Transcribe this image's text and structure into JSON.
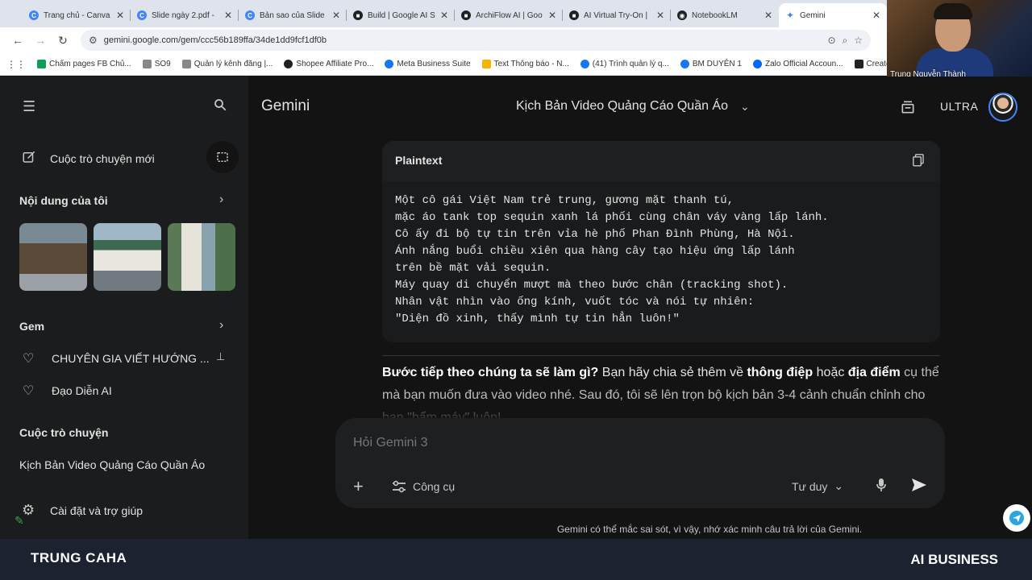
{
  "browser": {
    "tabs": [
      {
        "label": "Trang chủ - Canva",
        "color": "#4285f4"
      },
      {
        "label": "Slide ngày 2.pdf -",
        "color": "#4285f4"
      },
      {
        "label": "Bản sao của Slide",
        "color": "#4285f4"
      },
      {
        "label": "Build | Google AI S",
        "color": "#202124"
      },
      {
        "label": "ArchiFlow AI | Goo",
        "color": "#202124"
      },
      {
        "label": "AI Virtual Try-On |",
        "color": "#202124"
      },
      {
        "label": "NotebookLM",
        "color": "#202124"
      },
      {
        "label": "Gemini",
        "color": "#4285f4"
      }
    ],
    "url": "gemini.google.com/gem/ccc56b189ffa/34de1dd9fcf1df0b",
    "bookmarks": [
      {
        "label": "Chấm pages FB Chủ...",
        "color": "#0f9d58"
      },
      {
        "label": "SO9",
        "color": "#888888"
      },
      {
        "label": "Quản lý kênh đăng |...",
        "color": "#888888"
      },
      {
        "label": "Shopee Affiliate Pro...",
        "color": "#222222"
      },
      {
        "label": "Meta Business Suite",
        "color": "#1877f2"
      },
      {
        "label": "Text Thông báo - N...",
        "color": "#f4b400"
      },
      {
        "label": "(41) Trình quản lý q...",
        "color": "#1877f2"
      },
      {
        "label": "BM DUYÊN 1",
        "color": "#1877f2"
      },
      {
        "label": "Zalo Official Accoun...",
        "color": "#0068ff"
      },
      {
        "label": "Create Vide",
        "color": "#222222"
      }
    ],
    "webcam_name": "Trung Nguyễn Thành"
  },
  "sidebar": {
    "new_chat": "Cuộc trò chuyện mới",
    "my_content": "Nội dung của tôi",
    "gem_heading": "Gem",
    "gems": [
      {
        "label": "CHUYÊN GIA VIẾT HƯỚNG ..."
      },
      {
        "label": "Đạo Diễn AI"
      }
    ],
    "chats_heading": "Cuộc trò chuyện",
    "chats": [
      {
        "label": "Kịch Bản Video Quảng Cáo Quần Áo"
      }
    ],
    "settings": "Cài đặt và trợ giúp"
  },
  "header": {
    "brand": "Gemini",
    "conversation_title": "Kịch Bản Video Quảng Cáo Quần Áo",
    "plan": "ULTRA"
  },
  "code_block": {
    "language": "Plaintext",
    "lines": [
      "Một cô gái Việt Nam trẻ trung, gương mặt thanh tú,",
      "mặc áo tank top sequin xanh lá phối cùng chân váy vàng lấp lánh.",
      "Cô ấy đi bộ tự tin trên vỉa hè phố Phan Đình Phùng, Hà Nội.",
      "Ánh nắng buổi chiều xiên qua hàng cây tạo hiệu ứng lấp lánh",
      "trên bề mặt vải sequin.",
      "Máy quay di chuyển mượt mà theo bước chân (tracking shot).",
      "Nhân vật nhìn vào ống kính, vuốt tóc và nói tự nhiên:",
      "\"Diện đồ xinh, thấy mình tự tin hẳn luôn!\""
    ]
  },
  "reply": {
    "q_bold": "Bước tiếp theo chúng ta sẽ làm gì?",
    "t1": " Bạn hãy chia sẻ thêm về ",
    "b1": "thông điệp",
    "t2": " hoặc ",
    "b2": "địa điểm",
    "t3": " cụ thể mà bạn muốn đưa vào video nhé. Sau đó, tôi sẽ lên trọn bộ kịch bản 3-4 cảnh chuẩn chỉnh cho bạn \"bấm máy\" luôn!"
  },
  "composer": {
    "placeholder": "Hỏi Gemini 3",
    "tools_label": "Công cụ",
    "mode_label": "Tư duy"
  },
  "disclaimer": "Gemini có thể mắc sai sót, vì vậy, nhớ xác minh câu trả lời của Gemini.",
  "banner": {
    "left": "TRUNG CAHA",
    "right": "AI BUSINESS"
  }
}
